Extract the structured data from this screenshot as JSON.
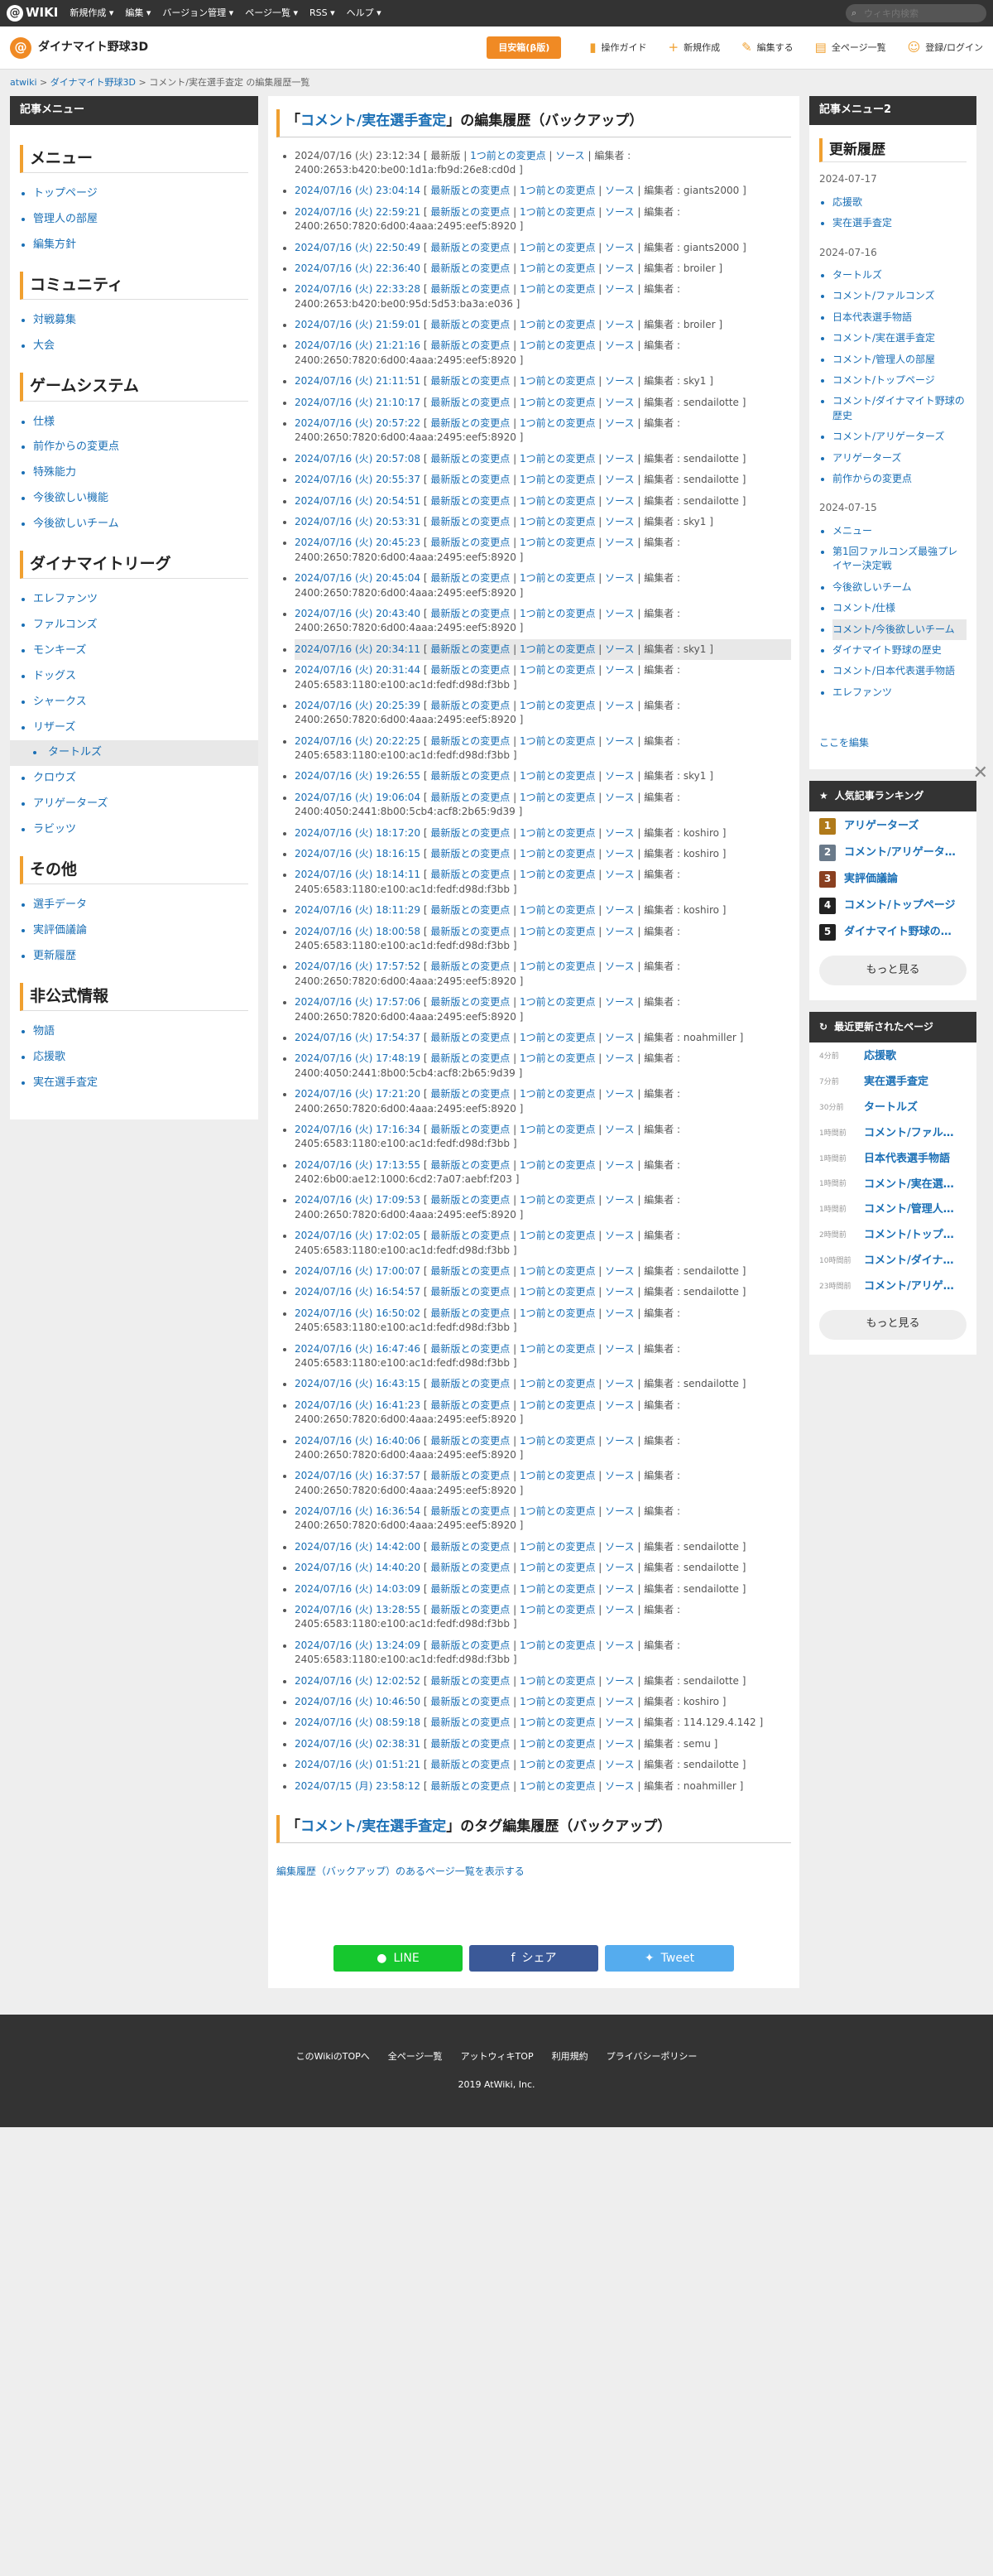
{
  "topbar": {
    "menus": [
      "新規作成 ▾",
      "編集 ▾",
      "バージョン管理 ▾",
      "ページ一覧 ▾",
      "RSS ▾",
      "ヘルプ ▾"
    ],
    "search_placeholder": "ウィキ内検索"
  },
  "site": {
    "title": "ダイナマイト野球3D",
    "beginner": "目安箱(β版)",
    "actions": [
      "操作ガイド",
      "新規作成",
      "編集する",
      "全ページ一覧",
      "登録/ログイン"
    ]
  },
  "breadcrumb": {
    "l1": "atwiki",
    "l2": "ダイナマイト野球3D",
    "current": "コメント/実在選手査定 の編集履歴一覧"
  },
  "left": {
    "header": "記事メニュー",
    "sections": [
      {
        "title": "メニュー",
        "items": [
          "トップページ",
          "管理人の部屋",
          "編集方針"
        ]
      },
      {
        "title": "コミュニティ",
        "items": [
          "対戦募集",
          "大会"
        ]
      },
      {
        "title": "ゲームシステム",
        "items": [
          "仕様",
          "前作からの変更点",
          "特殊能力",
          "今後欲しい機能",
          "今後欲しいチーム"
        ]
      },
      {
        "title": "ダイナマイトリーグ",
        "items": [
          "エレファンツ",
          "ファルコンズ",
          "モンキーズ",
          "ドッグス",
          "シャークス",
          "リザーズ",
          "タートルズ",
          "クロウズ",
          "アリゲーターズ",
          "ラビッツ"
        ]
      },
      {
        "title": "その他",
        "items": [
          "選手データ",
          "実評価議論",
          "更新履歴"
        ]
      },
      {
        "title": "非公式情報",
        "items": [
          "物語",
          "応援歌",
          "実在選手査定"
        ]
      }
    ]
  },
  "main": {
    "title_q1": "「",
    "title_page": "コメント/実在選手査定",
    "title_q2": "」",
    "title_rest": "の編集履歴（バックアップ）",
    "link_latest": "最新版との変更点",
    "link_prev": "1つ前との変更点",
    "link_src": "ソース",
    "editor_label": "編集者",
    "first": {
      "date": "2024/07/16 (火) 23:12:34",
      "latest": "最新版",
      "editor": "2400:2653:b420:be00:1d1a:fb9d:26e8:cd0d"
    },
    "history": [
      {
        "date": "2024/07/16 (火) 23:04:14",
        "editor": "giants2000"
      },
      {
        "date": "2024/07/16 (火) 22:59:21",
        "editor": "2400:2650:7820:6d00:4aaa:2495:eef5:8920"
      },
      {
        "date": "2024/07/16 (火) 22:50:49",
        "editor": "giants2000"
      },
      {
        "date": "2024/07/16 (火) 22:36:40",
        "editor": "broiler"
      },
      {
        "date": "2024/07/16 (火) 22:33:28",
        "editor": "2400:2653:b420:be00:95d:5d53:ba3a:e036"
      },
      {
        "date": "2024/07/16 (火) 21:59:01",
        "editor": "broiler"
      },
      {
        "date": "2024/07/16 (火) 21:21:16",
        "editor": "2400:2650:7820:6d00:4aaa:2495:eef5:8920"
      },
      {
        "date": "2024/07/16 (火) 21:11:51",
        "editor": "sky1"
      },
      {
        "date": "2024/07/16 (火) 21:10:17",
        "editor": "sendailotte"
      },
      {
        "date": "2024/07/16 (火) 20:57:22",
        "editor": "2400:2650:7820:6d00:4aaa:2495:eef5:8920"
      },
      {
        "date": "2024/07/16 (火) 20:57:08",
        "editor": "sendailotte"
      },
      {
        "date": "2024/07/16 (火) 20:55:37",
        "editor": "sendailotte"
      },
      {
        "date": "2024/07/16 (火) 20:54:51",
        "editor": "sendailotte"
      },
      {
        "date": "2024/07/16 (火) 20:53:31",
        "editor": "sky1"
      },
      {
        "date": "2024/07/16 (火) 20:45:23",
        "editor": "2400:2650:7820:6d00:4aaa:2495:eef5:8920"
      },
      {
        "date": "2024/07/16 (火) 20:45:04",
        "editor": "2400:2650:7820:6d00:4aaa:2495:eef5:8920"
      },
      {
        "date": "2024/07/16 (火) 20:43:40",
        "editor": "2400:2650:7820:6d00:4aaa:2495:eef5:8920"
      },
      {
        "date": "2024/07/16 (火) 20:34:11",
        "editor": "sky1"
      },
      {
        "date": "2024/07/16 (火) 20:31:44",
        "editor": "2405:6583:1180:e100:ac1d:fedf:d98d:f3bb"
      },
      {
        "date": "2024/07/16 (火) 20:25:39",
        "editor": "2400:2650:7820:6d00:4aaa:2495:eef5:8920"
      },
      {
        "date": "2024/07/16 (火) 20:22:25",
        "editor": "2405:6583:1180:e100:ac1d:fedf:d98d:f3bb"
      },
      {
        "date": "2024/07/16 (火) 19:26:55",
        "editor": "sky1"
      },
      {
        "date": "2024/07/16 (火) 19:06:04",
        "editor": "2400:4050:2441:8b00:5cb4:acf8:2b65:9d39"
      },
      {
        "date": "2024/07/16 (火) 18:17:20",
        "editor": "koshiro"
      },
      {
        "date": "2024/07/16 (火) 18:16:15",
        "editor": "koshiro"
      },
      {
        "date": "2024/07/16 (火) 18:14:11",
        "editor": "2405:6583:1180:e100:ac1d:fedf:d98d:f3bb"
      },
      {
        "date": "2024/07/16 (火) 18:11:29",
        "editor": "koshiro"
      },
      {
        "date": "2024/07/16 (火) 18:00:58",
        "editor": "2405:6583:1180:e100:ac1d:fedf:d98d:f3bb"
      },
      {
        "date": "2024/07/16 (火) 17:57:52",
        "editor": "2400:2650:7820:6d00:4aaa:2495:eef5:8920"
      },
      {
        "date": "2024/07/16 (火) 17:57:06",
        "editor": "2400:2650:7820:6d00:4aaa:2495:eef5:8920"
      },
      {
        "date": "2024/07/16 (火) 17:54:37",
        "editor": "noahmiller"
      },
      {
        "date": "2024/07/16 (火) 17:48:19",
        "editor": "2400:4050:2441:8b00:5cb4:acf8:2b65:9d39"
      },
      {
        "date": "2024/07/16 (火) 17:21:20",
        "editor": "2400:2650:7820:6d00:4aaa:2495:eef5:8920"
      },
      {
        "date": "2024/07/16 (火) 17:16:34",
        "editor": "2405:6583:1180:e100:ac1d:fedf:d98d:f3bb"
      },
      {
        "date": "2024/07/16 (火) 17:13:55",
        "editor": "2402:6b00:ae12:1000:6cd2:7a07:aebf:f203"
      },
      {
        "date": "2024/07/16 (火) 17:09:53",
        "editor": "2400:2650:7820:6d00:4aaa:2495:eef5:8920"
      },
      {
        "date": "2024/07/16 (火) 17:02:05",
        "editor": "2405:6583:1180:e100:ac1d:fedf:d98d:f3bb"
      },
      {
        "date": "2024/07/16 (火) 17:00:07",
        "editor": "sendailotte"
      },
      {
        "date": "2024/07/16 (火) 16:54:57",
        "editor": "sendailotte"
      },
      {
        "date": "2024/07/16 (火) 16:50:02",
        "editor": "2405:6583:1180:e100:ac1d:fedf:d98d:f3bb"
      },
      {
        "date": "2024/07/16 (火) 16:47:46",
        "editor": "2405:6583:1180:e100:ac1d:fedf:d98d:f3bb"
      },
      {
        "date": "2024/07/16 (火) 16:43:15",
        "editor": "sendailotte"
      },
      {
        "date": "2024/07/16 (火) 16:41:23",
        "editor": "2400:2650:7820:6d00:4aaa:2495:eef5:8920"
      },
      {
        "date": "2024/07/16 (火) 16:40:06",
        "editor": "2400:2650:7820:6d00:4aaa:2495:eef5:8920"
      },
      {
        "date": "2024/07/16 (火) 16:37:57",
        "editor": "2400:2650:7820:6d00:4aaa:2495:eef5:8920"
      },
      {
        "date": "2024/07/16 (火) 16:36:54",
        "editor": "2400:2650:7820:6d00:4aaa:2495:eef5:8920"
      },
      {
        "date": "2024/07/16 (火) 14:42:00",
        "editor": "sendailotte"
      },
      {
        "date": "2024/07/16 (火) 14:40:20",
        "editor": "sendailotte"
      },
      {
        "date": "2024/07/16 (火) 14:03:09",
        "editor": "sendailotte"
      },
      {
        "date": "2024/07/16 (火) 13:28:55",
        "editor": "2405:6583:1180:e100:ac1d:fedf:d98d:f3bb"
      },
      {
        "date": "2024/07/16 (火) 13:24:09",
        "editor": "2405:6583:1180:e100:ac1d:fedf:d98d:f3bb"
      },
      {
        "date": "2024/07/16 (火) 12:02:52",
        "editor": "sendailotte"
      },
      {
        "date": "2024/07/16 (火) 10:46:50",
        "editor": "koshiro"
      },
      {
        "date": "2024/07/16 (火) 08:59:18",
        "editor": "114.129.4.142"
      },
      {
        "date": "2024/07/16 (火) 02:38:31",
        "editor": "semu"
      },
      {
        "date": "2024/07/16 (火) 01:51:21",
        "editor": "sendailotte"
      },
      {
        "date": "2024/07/15 (月) 23:58:12",
        "editor": "noahmiller"
      }
    ],
    "tag_title_rest": "のタグ編集履歴（バックアップ）",
    "backup_link": "編集履歴（バックアップ）のあるページ一覧を表示する",
    "share": {
      "line": "LINE",
      "fb": "シェア",
      "tw": "Tweet"
    }
  },
  "right": {
    "header": "記事メニュー2",
    "update_title": "更新履歴",
    "groups": [
      {
        "date": "2024-07-17",
        "items": [
          "応援歌",
          "実在選手査定"
        ]
      },
      {
        "date": "2024-07-16",
        "items": [
          "タートルズ",
          "コメント/ファルコンズ",
          "日本代表選手物語",
          "コメント/実在選手査定",
          "コメント/管理人の部屋",
          "コメント/トップページ",
          "コメント/ダイナマイト野球の歴史",
          "コメント/アリゲーターズ",
          "アリゲーターズ",
          "前作からの変更点"
        ]
      },
      {
        "date": "2024-07-15",
        "items": [
          "メニュー",
          "第1回ファルコンズ最強プレイヤー決定戦",
          "今後欲しいチーム",
          "コメント/仕様",
          "コメント/今後欲しいチーム",
          "ダイナマイト野球の歴史",
          "コメント/日本代表選手物語",
          "エレファンツ"
        ]
      }
    ],
    "edit_here": "ここを編集",
    "ranking": {
      "title": "人気記事ランキング",
      "items": [
        {
          "n": "1",
          "t": "アリゲーターズ",
          "c": "#b07a1a"
        },
        {
          "n": "2",
          "t": "コメント/アリゲーターズ",
          "c": "#6a7a8a"
        },
        {
          "n": "3",
          "t": "実評価議論",
          "c": "#8a4020"
        },
        {
          "n": "4",
          "t": "コメント/トップページ",
          "c": "#222222"
        },
        {
          "n": "5",
          "t": "ダイナマイト野球の歴史",
          "c": "#222222"
        }
      ],
      "more": "もっと見る"
    },
    "recent": {
      "title": "最近更新されたページ",
      "items": [
        {
          "ago": "4分前",
          "t": "応援歌"
        },
        {
          "ago": "7分前",
          "t": "実在選手査定"
        },
        {
          "ago": "30分前",
          "t": "タートルズ"
        },
        {
          "ago": "1時間前",
          "t": "コメント/ファルコンズ"
        },
        {
          "ago": "1時間前",
          "t": "日本代表選手物語"
        },
        {
          "ago": "1時間前",
          "t": "コメント/実在選手査定"
        },
        {
          "ago": "1時間前",
          "t": "コメント/管理人の部屋"
        },
        {
          "ago": "2時間前",
          "t": "コメント/トップページ"
        },
        {
          "ago": "10時間前",
          "t": "コメント/ダイナマイト野球の歴史"
        },
        {
          "ago": "23時間前",
          "t": "コメント/アリゲーターズ"
        }
      ],
      "more": "もっと見る"
    }
  },
  "footer": {
    "links": [
      "このWikiのTOPへ",
      "全ページ一覧",
      "アットウィキTOP",
      "利用規約",
      "プライバシーポリシー"
    ],
    "copy": "2019 AtWiki, Inc."
  }
}
